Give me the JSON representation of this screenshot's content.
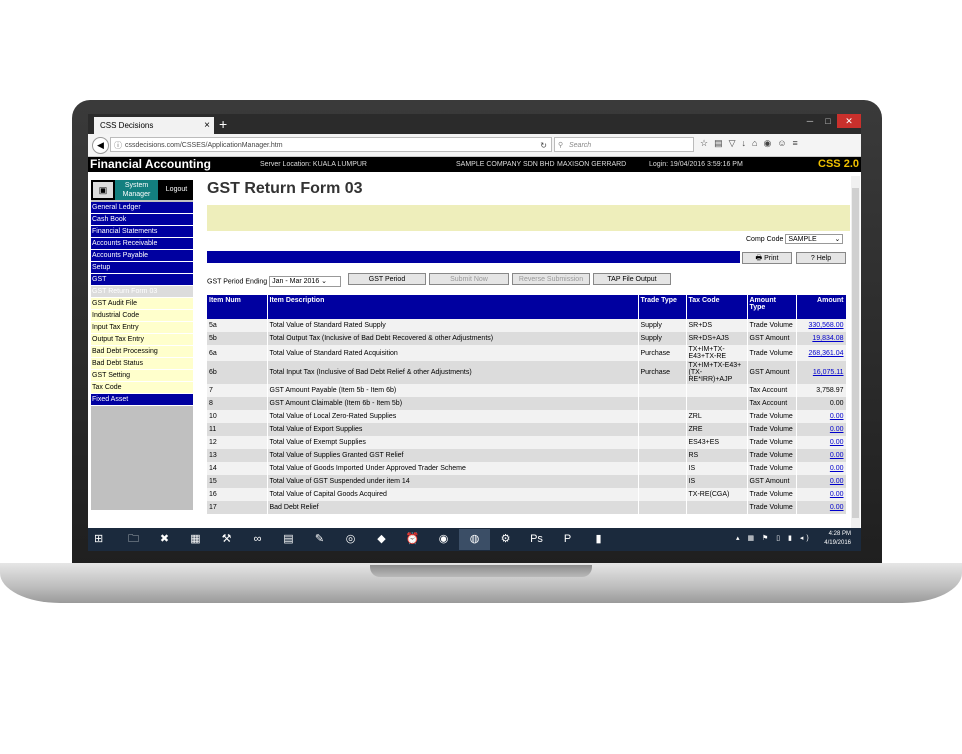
{
  "browser": {
    "tab_title": "CSS Decisions",
    "tab_close": "×",
    "new_tab": "+",
    "url": "cssdecisions.com/CSSES/ApplicationManager.htm",
    "search_placeholder": "Search"
  },
  "app_header": {
    "title": "Financial Accounting",
    "server": "Server Location: KUALA LUMPUR",
    "company": "SAMPLE COMPANY SDN BHD",
    "user": "MAXISON GERRARD",
    "login": "Login: 19/04/2016 3:59:16 PM",
    "brand": "CSS 2.0"
  },
  "sidebar": {
    "system_manager": "System Manager",
    "logout": "Logout",
    "items": [
      {
        "label": "General Ledger",
        "style": "blue"
      },
      {
        "label": "Cash Book",
        "style": "blue"
      },
      {
        "label": "Financial Statements",
        "style": "blue"
      },
      {
        "label": "Accounts Receivable",
        "style": "blue"
      },
      {
        "label": "Accounts Payable",
        "style": "blue"
      },
      {
        "label": "Setup",
        "style": "blue"
      },
      {
        "label": "GST",
        "style": "blue"
      },
      {
        "label": "GST Return Form 03",
        "style": "sel"
      },
      {
        "label": "GST Audit File",
        "style": "yel"
      },
      {
        "label": "Industrial Code",
        "style": "yel"
      },
      {
        "label": "Input Tax Entry",
        "style": "yel"
      },
      {
        "label": "Output Tax Entry",
        "style": "yel"
      },
      {
        "label": "Bad Debt Processing",
        "style": "yel"
      },
      {
        "label": "Bad Debt Status",
        "style": "yel"
      },
      {
        "label": "GST Setting",
        "style": "yel"
      },
      {
        "label": "Tax Code",
        "style": "yel"
      },
      {
        "label": "Fixed Asset",
        "style": "blue"
      }
    ]
  },
  "main": {
    "title": "GST Return Form 03",
    "comp_code_label": "Comp Code",
    "comp_code_value": "SAMPLE",
    "print_label": "Print",
    "help_label": "Help",
    "period_label": "GST Period Ending",
    "period_value": "Jan - Mar 2016",
    "buttons": {
      "gst_period": "GST Period",
      "submit_now": "Submit Now",
      "reverse_submission": "Reverse Submission",
      "tap_file_output": "TAP File Output"
    },
    "table": {
      "headers": [
        "Item Num",
        "Item Description",
        "Trade Type",
        "Tax Code",
        "Amount Type",
        "Amount"
      ],
      "rows": [
        {
          "num": "5a",
          "desc": "Total Value of Standard Rated Supply",
          "trade": "Supply",
          "code": "SR+DS",
          "atype": "Trade Volume",
          "amount": "330,568.00",
          "link": true
        },
        {
          "num": "5b",
          "desc": "Total Output Tax (Inclusive of Bad Debt Recovered & other Adjustments)",
          "trade": "Supply",
          "code": "SR+DS+AJS",
          "atype": "GST Amount",
          "amount": "19,834.08",
          "link": true
        },
        {
          "num": "6a",
          "desc": "Total Value of Standard Rated Acquisition",
          "trade": "Purchase",
          "code": "TX+IM+TX-E43+TX-RE",
          "atype": "Trade Volume",
          "amount": "268,361.04",
          "link": true
        },
        {
          "num": "6b",
          "desc": "Total Input Tax (Inclusive of Bad Debt Relief & other Adjustments)",
          "trade": "Purchase",
          "code": "TX+IM+TX-E43+(TX-RE*IRR)+AJP",
          "atype": "GST Amount",
          "amount": "16,075.11",
          "link": true
        },
        {
          "num": "7",
          "desc": "GST Amount Payable (Item 5b - Item 6b)",
          "trade": "",
          "code": "",
          "atype": "Tax Account",
          "amount": "3,758.97",
          "link": false
        },
        {
          "num": "8",
          "desc": "GST Amount Claimable (Item 6b - Item 5b)",
          "trade": "",
          "code": "",
          "atype": "Tax Account",
          "amount": "0.00",
          "link": false
        },
        {
          "num": "10",
          "desc": "Total Value of Local Zero-Rated Supplies",
          "trade": "",
          "code": "ZRL",
          "atype": "Trade Volume",
          "amount": "0.00",
          "link": true
        },
        {
          "num": "11",
          "desc": "Total Value of Export Supplies",
          "trade": "",
          "code": "ZRE",
          "atype": "Trade Volume",
          "amount": "0.00",
          "link": true
        },
        {
          "num": "12",
          "desc": "Total Value of Exempt Supplies",
          "trade": "",
          "code": "ES43+ES",
          "atype": "Trade Volume",
          "amount": "0.00",
          "link": true
        },
        {
          "num": "13",
          "desc": "Total Value of Supplies Granted GST Relief",
          "trade": "",
          "code": "RS",
          "atype": "Trade Volume",
          "amount": "0.00",
          "link": true
        },
        {
          "num": "14",
          "desc": "Total Value of Goods Imported Under Approved Trader Scheme",
          "trade": "",
          "code": "IS",
          "atype": "Trade Volume",
          "amount": "0.00",
          "link": true
        },
        {
          "num": "15",
          "desc": "Total Value of GST Suspended under item 14",
          "trade": "",
          "code": "IS",
          "atype": "GST Amount",
          "amount": "0.00",
          "link": true
        },
        {
          "num": "16",
          "desc": "Total Value of Capital Goods Acquired",
          "trade": "",
          "code": "TX-RE(CGA)",
          "atype": "Trade Volume",
          "amount": "0.00",
          "link": true
        },
        {
          "num": "17",
          "desc": "Bad Debt Relief",
          "trade": "",
          "code": "",
          "atype": "Trade Volume",
          "amount": "0.00",
          "link": true
        }
      ]
    }
  },
  "taskbar": {
    "time": "4:28 PM",
    "date": "4/19/2016"
  },
  "colors": {
    "header_blue": "#0000a0",
    "menu_yellow": "#ffffcc",
    "band_yellow": "#eeeebb",
    "taskbar": "#1b2a3d"
  }
}
